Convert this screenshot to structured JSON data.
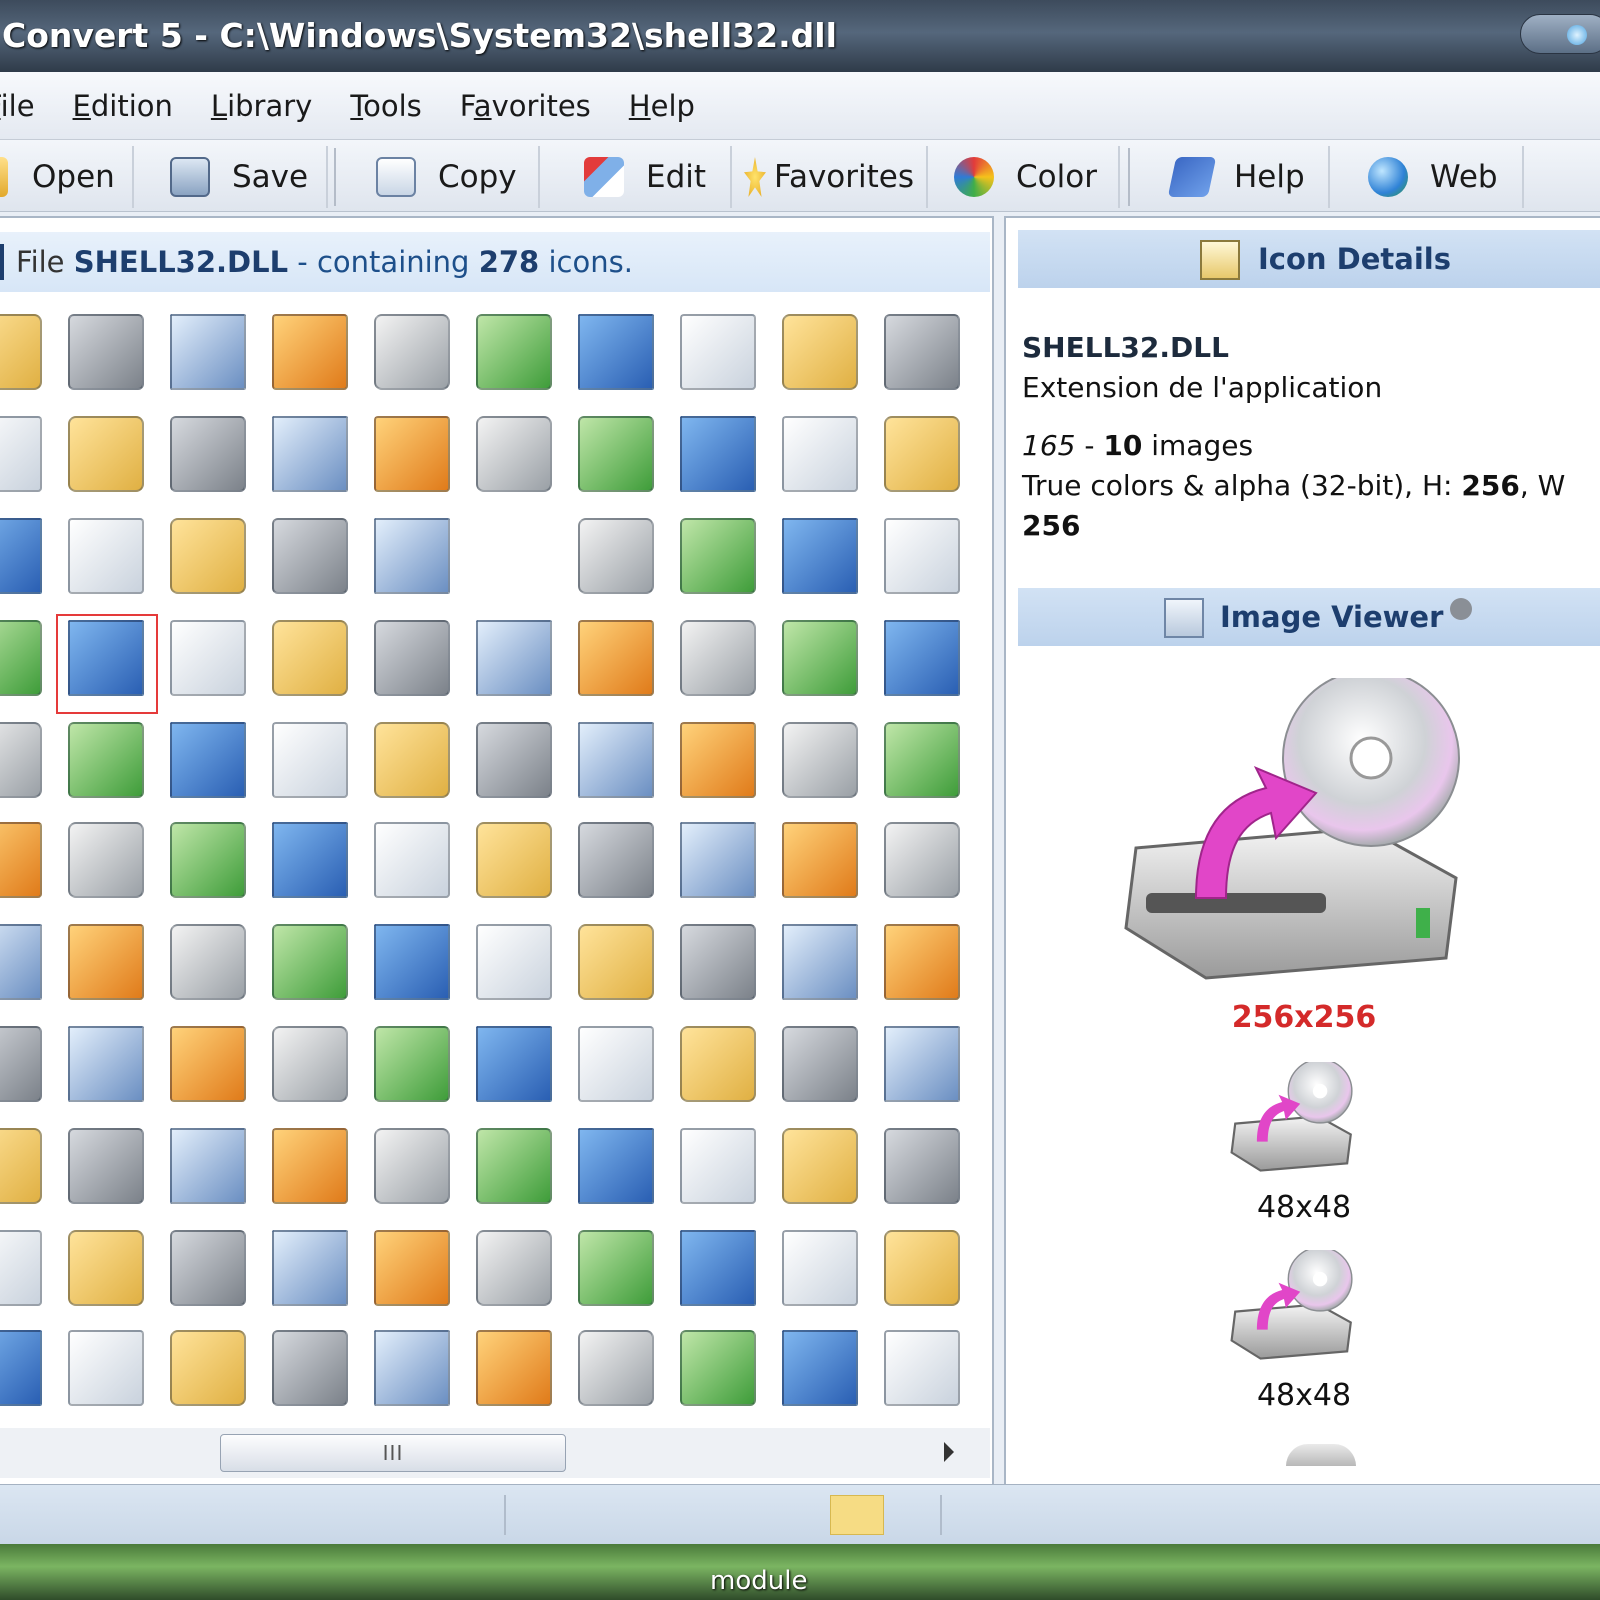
{
  "window": {
    "title": "Convert 5 - C:\\Windows\\System32\\shell32.dll"
  },
  "menu": [
    {
      "pre": "",
      "u": "F",
      "post": "ile"
    },
    {
      "pre": "",
      "u": "E",
      "post": "dition"
    },
    {
      "pre": "",
      "u": "L",
      "post": "ibrary"
    },
    {
      "pre": "",
      "u": "T",
      "post": "ools"
    },
    {
      "pre": "F",
      "u": "a",
      "post": "vorites"
    },
    {
      "pre": "",
      "u": "H",
      "post": "elp"
    }
  ],
  "toolbar": {
    "open": "Open",
    "save": "Save",
    "copy": "Copy",
    "edit": "Edit",
    "favorites": "Favorites",
    "color": "Color",
    "help": "Help",
    "web": "Web"
  },
  "file_header": {
    "prefix": "File ",
    "filename": "SHELL32.DLL",
    "middle": " - containing ",
    "count": "278",
    "suffix": " icons."
  },
  "icon_details": {
    "header": "Icon Details",
    "filename": "SHELL32.DLL",
    "description": "Extension de l'application",
    "index": "165",
    "sep": " - ",
    "image_count": "10",
    "images_word": " images",
    "format_prefix": "True colors & alpha (32-bit), H: ",
    "height": "256",
    "width_prefix": ", W",
    "width": "256"
  },
  "image_viewer": {
    "header": "Image Viewer",
    "sizes": [
      "256x256",
      "48x48",
      "48x48"
    ]
  },
  "scrollbar": {
    "thumb_grip": "III"
  },
  "taskbar": {
    "text": "module"
  },
  "colors": {
    "accent": "#1d3e6e",
    "selection_border": "#e53a3a",
    "selected_size": "#d42a2a"
  }
}
